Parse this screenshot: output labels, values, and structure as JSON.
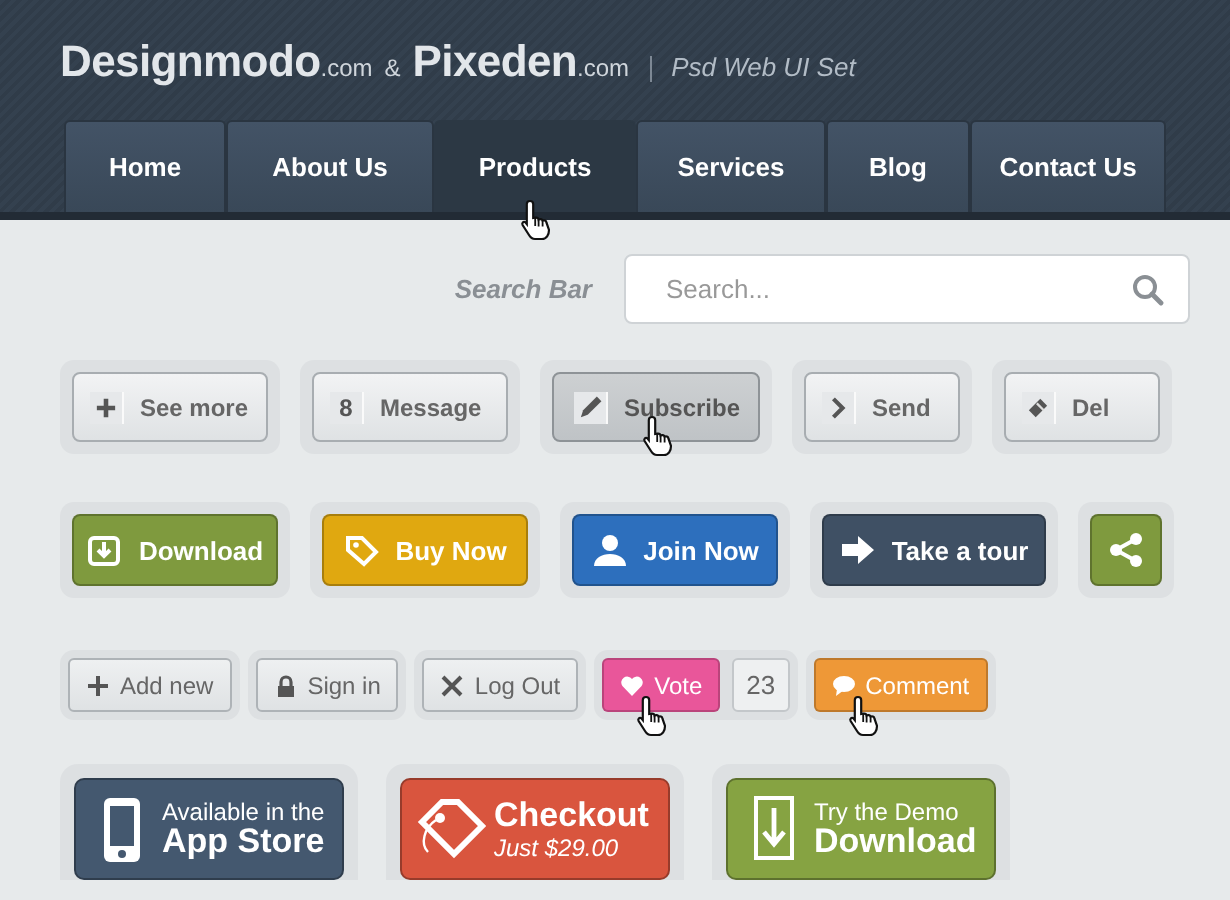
{
  "header": {
    "brands": [
      {
        "name": "Designmodo",
        "suffix": ".com"
      },
      {
        "name": "Pixeden",
        "suffix": ".com"
      }
    ],
    "ampersand": "&",
    "tagline": "Psd Web UI Set"
  },
  "nav": [
    {
      "label": "Home",
      "selected": false,
      "hovered": false
    },
    {
      "label": "About Us",
      "selected": false,
      "hovered": false
    },
    {
      "label": "Products",
      "selected": true,
      "hovered": true
    },
    {
      "label": "Services",
      "selected": false,
      "hovered": false
    },
    {
      "label": "Blog",
      "selected": false,
      "hovered": false
    },
    {
      "label": "Contact Us",
      "selected": false,
      "hovered": false
    }
  ],
  "search": {
    "label": "Search Bar",
    "placeholder": "Search..."
  },
  "plain_buttons": [
    {
      "label": "See more",
      "pressed": false,
      "hovered": false
    },
    {
      "label": "Message",
      "badge": "8",
      "pressed": false,
      "hovered": false
    },
    {
      "label": "Subscribe",
      "pressed": true,
      "hovered": true
    },
    {
      "label": "Send",
      "pressed": false,
      "hovered": false
    },
    {
      "label": "Del",
      "pressed": false,
      "hovered": false
    }
  ],
  "color_buttons": [
    {
      "label": "Download",
      "color": "#7f9a3e"
    },
    {
      "label": "Buy Now",
      "color": "#e0a810"
    },
    {
      "label": "Join Now",
      "color": "#2d6fbd"
    },
    {
      "label": "Take a tour",
      "color": "#3f5064"
    },
    {
      "color": "#7f9a3e"
    }
  ],
  "small_buttons": [
    {
      "kind": "plain",
      "label": "Add new",
      "hovered": false
    },
    {
      "kind": "plain",
      "label": "Sign in",
      "hovered": false
    },
    {
      "kind": "plain",
      "label": "Log Out",
      "hovered": false
    },
    {
      "kind": "vote",
      "label": "Vote",
      "count": "23",
      "color": "#e9569a",
      "hovered": true
    },
    {
      "kind": "colored",
      "label": "Comment",
      "color": "#ee9837",
      "hovered": true
    }
  ],
  "big_buttons": [
    {
      "top": "Available in the",
      "bottom": "App Store",
      "color": "#44586f"
    },
    {
      "top": "Checkout",
      "bottom": "Just $29.00",
      "color": "#d9553e"
    },
    {
      "top": "Try the Demo",
      "bottom": "Download",
      "color": "#86a342"
    }
  ]
}
